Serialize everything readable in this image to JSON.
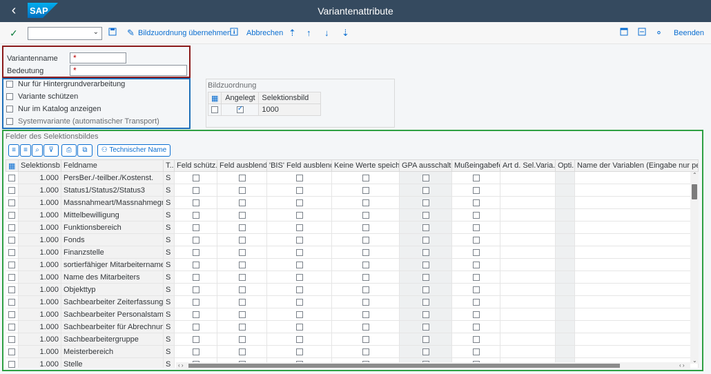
{
  "window": {
    "title": "Variantenattribute",
    "logo": "SAP"
  },
  "toolbar": {
    "command_value": "",
    "bildzuordnung_label": "Bildzuordnung übernehmen",
    "abbrechen_label": "Abbrechen",
    "beenden_label": "Beenden"
  },
  "header": {
    "variantenname_label": "Variantenname",
    "variantenname_required": "*",
    "bedeutung_label": "Bedeutung",
    "bedeutung_required": "*"
  },
  "options": [
    {
      "label": "Nur für Hintergrundverarbeitung",
      "checked": false
    },
    {
      "label": "Variante schützen",
      "checked": false
    },
    {
      "label": "Nur im Katalog anzeigen",
      "checked": false
    },
    {
      "label": "Systemvariante (automatischer Transport)",
      "checked": false
    }
  ],
  "bildzuordnung": {
    "title": "Bildzuordnung",
    "col_angelegt": "Angelegt",
    "col_selektionsbild": "Selektionsbild",
    "row_value": "1000"
  },
  "fields": {
    "title": "Felder des Selektionsbildes",
    "technischer_name_label": "Technischer Name",
    "columns": [
      "Selektionsb...",
      "Feldname",
      "T...",
      "Feld schütz...",
      "Feld ausblend...",
      "'BIS' Feld ausblend...",
      "Keine Werte speiche...",
      "GPA ausschalt...",
      "Mußeingabefe...",
      "Art d. Sel.Varia...",
      "Opti...",
      "Name der Variablen (Eingabe nur per"
    ],
    "rows": [
      {
        "sel": "1.000",
        "name": "PersBer./-teilber./Kostenst.",
        "typ": "S"
      },
      {
        "sel": "1.000",
        "name": "Status1/Status2/Status3",
        "typ": "S"
      },
      {
        "sel": "1.000",
        "name": "Massnahmeart/Massnahmegrund",
        "typ": "S"
      },
      {
        "sel": "1.000",
        "name": "Mittelbewilligung",
        "typ": "S"
      },
      {
        "sel": "1.000",
        "name": "Funktionsbereich",
        "typ": "S"
      },
      {
        "sel": "1.000",
        "name": "Fonds",
        "typ": "S"
      },
      {
        "sel": "1.000",
        "name": "Finanzstelle",
        "typ": "S"
      },
      {
        "sel": "1.000",
        "name": "sortierfähiger Mitarbeitername",
        "typ": "S"
      },
      {
        "sel": "1.000",
        "name": "Name des Mitarbeiters",
        "typ": "S"
      },
      {
        "sel": "1.000",
        "name": "Objekttyp",
        "typ": "S"
      },
      {
        "sel": "1.000",
        "name": "Sachbearbeiter Zeiterfassung",
        "typ": "S"
      },
      {
        "sel": "1.000",
        "name": "Sachbearbeiter Personalstammd.",
        "typ": "S"
      },
      {
        "sel": "1.000",
        "name": "Sachbearbeiter für Abrechnung",
        "typ": "S"
      },
      {
        "sel": "1.000",
        "name": "Sachbearbeitergruppe",
        "typ": "S"
      },
      {
        "sel": "1.000",
        "name": "Meisterbereich",
        "typ": "S"
      },
      {
        "sel": "1.000",
        "name": "Stelle",
        "typ": "S"
      }
    ]
  }
}
